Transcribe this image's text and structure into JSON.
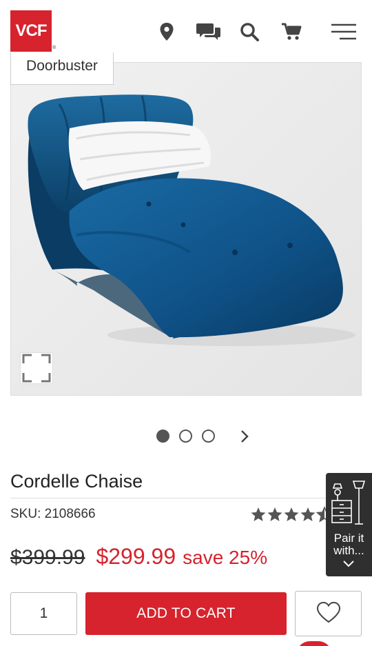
{
  "header": {
    "logo_text": "VCF",
    "logo_mark": "®",
    "brand_color": "#d6232d",
    "icons": [
      "location-pin-icon",
      "chat-icon",
      "search-icon",
      "cart-icon",
      "menu-icon"
    ]
  },
  "hero": {
    "badge": "Doorbuster",
    "expand_icon": "expand-icon"
  },
  "carousel": {
    "slide_count": 3,
    "active_index": 0,
    "next_icon": "chevron-right-icon"
  },
  "product": {
    "title": "Cordelle Chaise",
    "sku": "SKU: 2108666",
    "rating_stars": 4.5,
    "rating_max": 5,
    "original_price": "$399.99",
    "sale_price": "$299.99",
    "savings": "save 25%"
  },
  "cart": {
    "quantity": "1",
    "add_to_cart_label": "ADD TO CART",
    "wishlist_icon": "heart-icon"
  },
  "pair_widget": {
    "label_line1": "Pair it",
    "label_line2": "with...",
    "icon": "furniture-icon",
    "chevron": "chevron-down-icon"
  }
}
